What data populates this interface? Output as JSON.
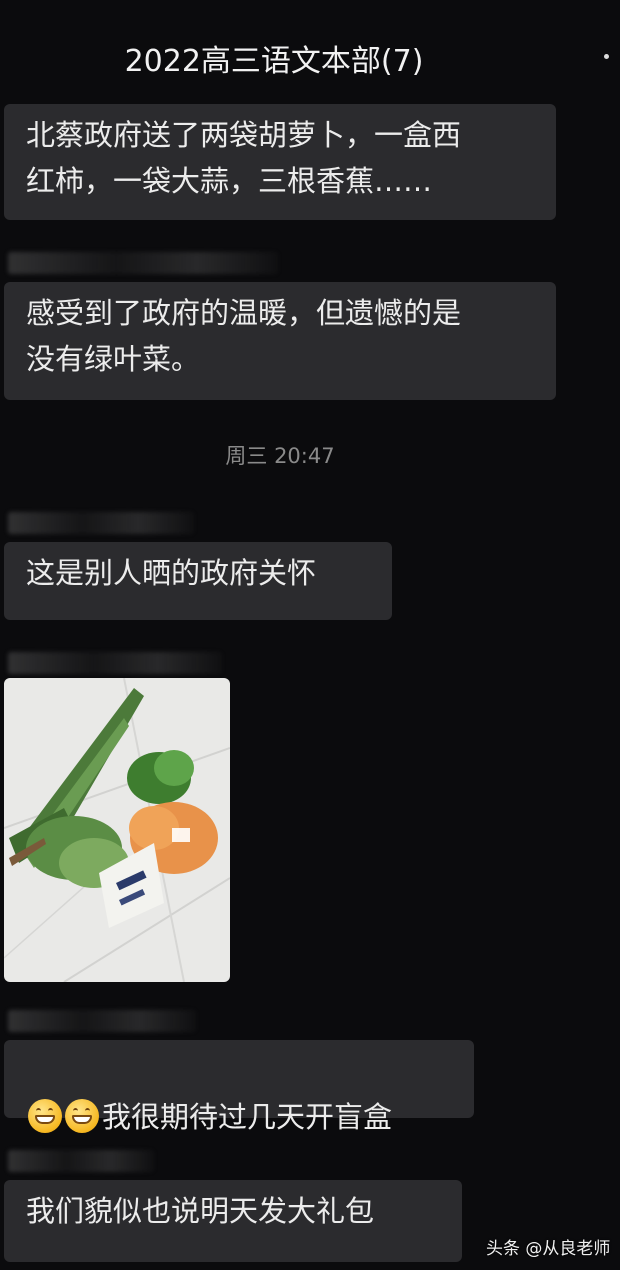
{
  "header": {
    "chat_title": "2022高三语文本部(7)"
  },
  "messages": [
    {
      "id": "m1",
      "text": "北蔡政府送了两袋胡萝卜，一盒西\n红柿，一袋大蒜，三根香蕉……"
    },
    {
      "id": "m2",
      "text": "感受到了政府的温暖，但遗憾的是\n没有绿叶菜。"
    },
    {
      "id": "m3",
      "text": "这是别人晒的政府关怀"
    },
    {
      "id": "m4",
      "photo_alt": "vegetables-on-floor"
    },
    {
      "id": "m5",
      "emoji": "grinning-face-icon",
      "text": "我很期待过几天开盲盒"
    },
    {
      "id": "m6",
      "text": "我们貌似也说明天发大礼包"
    }
  ],
  "timestamp": "周三 20:47",
  "watermark": "头条 @从良老师",
  "colors": {
    "background": "#0b0b0d",
    "bubble": "#2b2b2e",
    "text": "#ececec",
    "timestamp": "#8a8a8a"
  }
}
